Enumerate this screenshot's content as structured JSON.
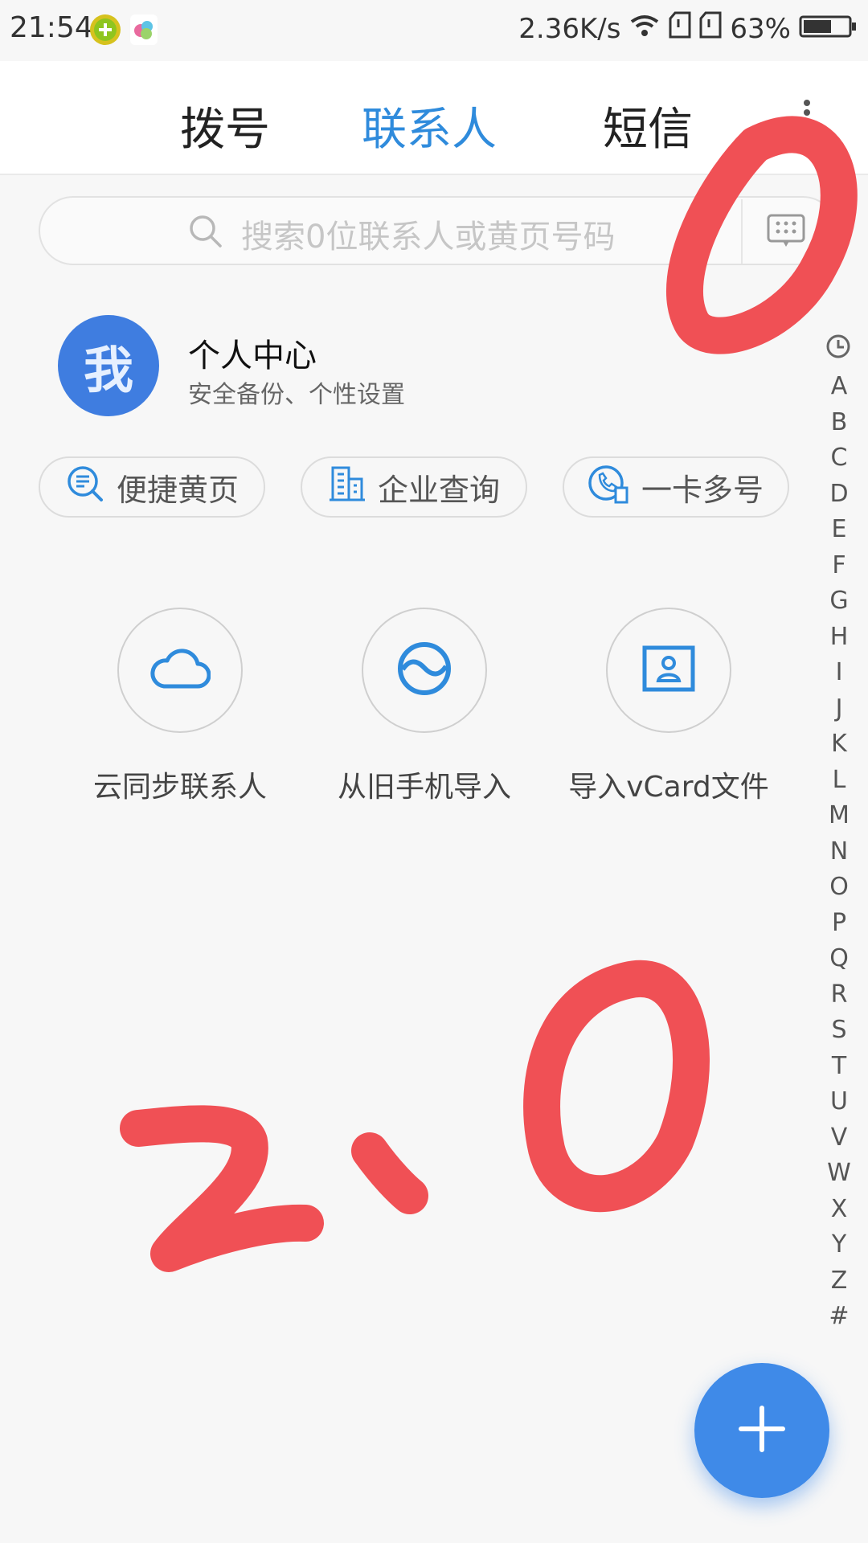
{
  "status_bar": {
    "time": "21:54",
    "speed": "2.36K/s",
    "battery": "63%",
    "icons": [
      "notification-app-icon",
      "notification-app-icon-2",
      "wifi-icon",
      "sim-icon",
      "sim-icon-2",
      "battery-icon"
    ]
  },
  "tabs": [
    {
      "label": "拨号",
      "active": false
    },
    {
      "label": "联系人",
      "active": true
    },
    {
      "label": "短信",
      "active": false
    }
  ],
  "search": {
    "placeholder": "搜索0位联系人或黄页号码"
  },
  "profile": {
    "avatar_text": "我",
    "title": "个人中心",
    "subtitle": "安全备份、个性设置"
  },
  "quick_links": [
    {
      "label": "便捷黄页",
      "icon": "search-list-icon"
    },
    {
      "label": "企业查询",
      "icon": "building-icon"
    },
    {
      "label": "一卡多号",
      "icon": "phone-sim-icon"
    }
  ],
  "actions": [
    {
      "label": "云同步联系人",
      "icon": "cloud-icon"
    },
    {
      "label": "从旧手机导入",
      "icon": "sync-icon"
    },
    {
      "label": "导入vCard文件",
      "icon": "contact-card-icon"
    }
  ],
  "index_letters": [
    "A",
    "B",
    "C",
    "D",
    "E",
    "F",
    "G",
    "H",
    "I",
    "J",
    "K",
    "L",
    "M",
    "N",
    "O",
    "P",
    "Q",
    "R",
    "S",
    "T",
    "U",
    "V",
    "W",
    "X",
    "Y",
    "Z",
    "#"
  ],
  "colors": {
    "accent": "#2f8bdc",
    "avatar": "#3f7de0",
    "fab": "#3f8ae8",
    "annotation": "#f05055"
  }
}
